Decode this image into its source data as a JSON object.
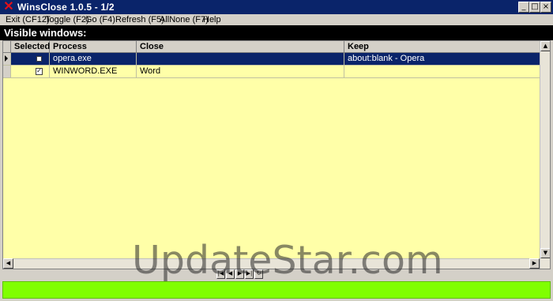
{
  "window": {
    "title": "WinsClose 1.0.5 - 1/2",
    "app_icon": "red-x-icon",
    "controls": {
      "minimize": "_",
      "maximize": "□",
      "close": "×"
    }
  },
  "menu": [
    {
      "label": "Exit (CF12)"
    },
    {
      "label": "Toggle (F2)"
    },
    {
      "label": "Go (F4)"
    },
    {
      "label": "Refresh (F5)"
    },
    {
      "label": "AllNone (F7)"
    },
    {
      "label": "Help"
    }
  ],
  "section_title": "Visible windows:",
  "grid": {
    "columns": [
      "Selected",
      "Process",
      "Close",
      "Keep"
    ],
    "rows": [
      {
        "selected": false,
        "process": "opera.exe",
        "close": "",
        "keep": "about:blank - Opera",
        "current": true
      },
      {
        "selected": true,
        "process": "WINWORD.EXE",
        "close": "Word",
        "keep": "",
        "current": false
      }
    ],
    "background_color": "#ffffa8",
    "selection_color": "#0a246a"
  },
  "navigator": [
    "|◀",
    "◀",
    "▶",
    "▶|",
    "↻"
  ],
  "status_color": "#80ff00",
  "watermark": "UpdateStar.com"
}
